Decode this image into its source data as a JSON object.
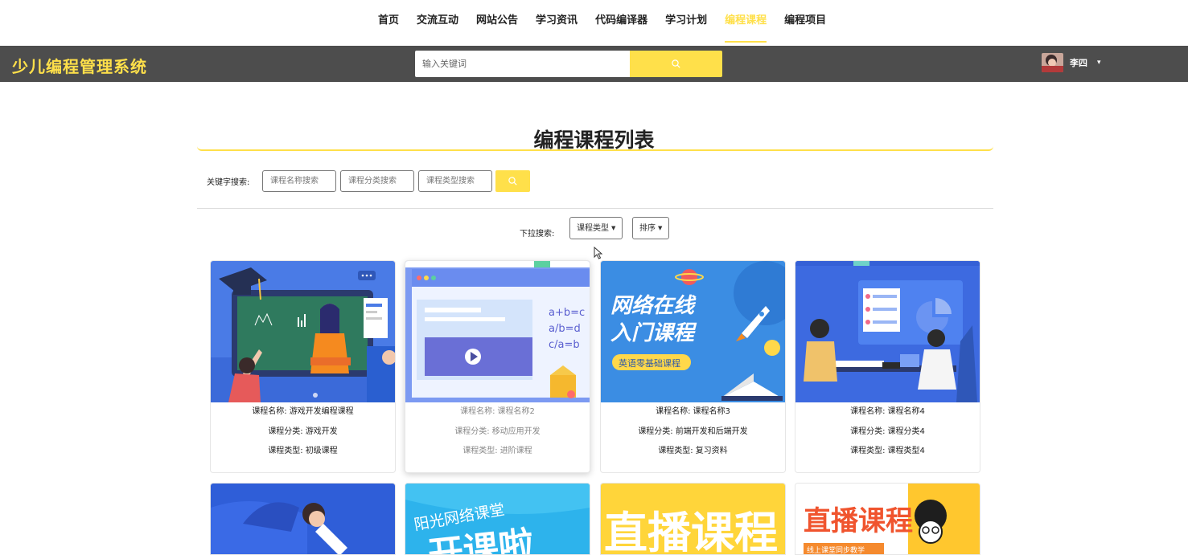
{
  "nav": {
    "items": [
      {
        "label": "首页",
        "active": false
      },
      {
        "label": "交流互动",
        "active": false
      },
      {
        "label": "网站公告",
        "active": false
      },
      {
        "label": "学习资讯",
        "active": false
      },
      {
        "label": "代码编译器",
        "active": false
      },
      {
        "label": "学习计划",
        "active": false
      },
      {
        "label": "编程课程",
        "active": true
      },
      {
        "label": "编程项目",
        "active": false
      }
    ]
  },
  "header": {
    "logo": "少儿编程管理系统",
    "search_placeholder": "输入关键词",
    "user_name": "李四",
    "user_caret": "▾"
  },
  "page": {
    "title": "编程课程列表",
    "keyword_label": "关键字搜索:",
    "keyword_inputs": [
      "课程名称搜索",
      "课程分类搜索",
      "课程类型搜索"
    ],
    "dropdown_label": "下拉搜索:",
    "dropdowns": [
      "课程类型",
      "排序"
    ]
  },
  "colors": {
    "accent": "#ffe04a",
    "header_bg": "#4d4d4d"
  },
  "cards": [
    {
      "name_label": "课程名称:",
      "name": "游戏开发编程课程",
      "cat_label": "课程分类:",
      "cat": "游戏开发",
      "type_label": "课程类型:",
      "type": "初级课程"
    },
    {
      "name_label": "课程名称:",
      "name": "课程名称2",
      "cat_label": "课程分类:",
      "cat": "移动应用开发",
      "type_label": "课程类型:",
      "type": "进阶课程"
    },
    {
      "name_label": "课程名称:",
      "name": "课程名称3",
      "cat_label": "课程分类:",
      "cat": "前端开发和后端开发",
      "type_label": "课程类型:",
      "type": "复习资料"
    },
    {
      "name_label": "课程名称:",
      "name": "课程名称4",
      "cat_label": "课程分类:",
      "cat": "课程分类4",
      "type_label": "课程类型:",
      "type": "课程类型4"
    }
  ],
  "banners": {
    "card3_title1": "网络在线",
    "card3_title2": "入门课程",
    "card3_sub": "英语零基础课程",
    "card2_formula": [
      "a+b=c",
      "a/b=d",
      "c/a=b"
    ],
    "row2_card2_text1": "阳光网络课堂",
    "row2_card2_text2": "开课啦",
    "row2_card3_text": "直播课程",
    "row2_card4_text": "直播课程",
    "row2_card4_sub": "线上课堂同步教学"
  }
}
